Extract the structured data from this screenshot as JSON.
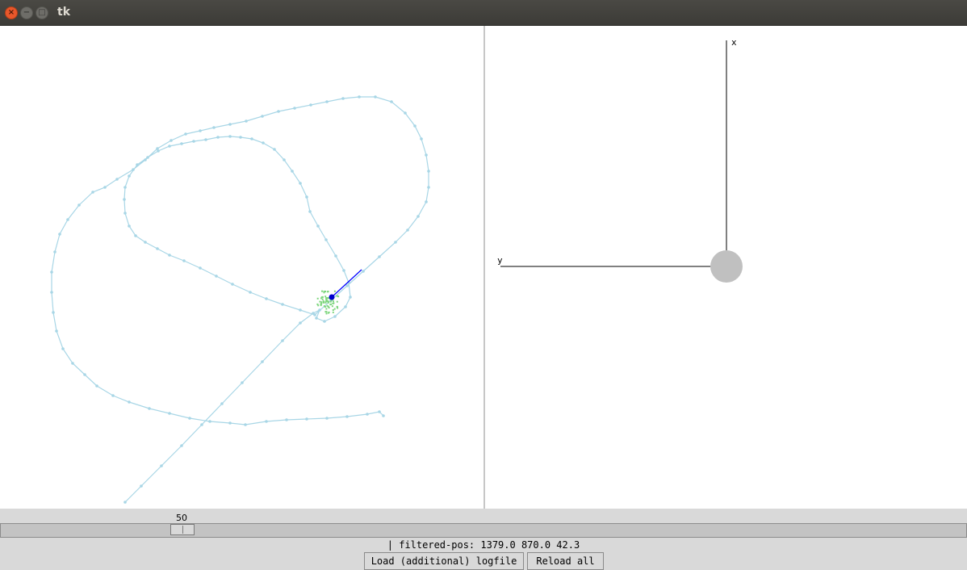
{
  "window": {
    "title": "tk"
  },
  "titlebar_buttons": {
    "close": "×",
    "minimize": "−",
    "maximize": "□"
  },
  "colors": {
    "track": "#a8d6e6",
    "particles": "#7ed67e",
    "heading": "#0000ff",
    "robot_body": "#c0c0c0",
    "axis": "#000000"
  },
  "robot_view": {
    "x_axis_label": "x",
    "y_axis_label": "y"
  },
  "slider": {
    "value": "50"
  },
  "status": {
    "text": "| filtered-pos: 1379.0 870.0 42.3"
  },
  "buttons": {
    "load_label": "Load (additional) logfile",
    "reload_label": "Reload all"
  }
}
